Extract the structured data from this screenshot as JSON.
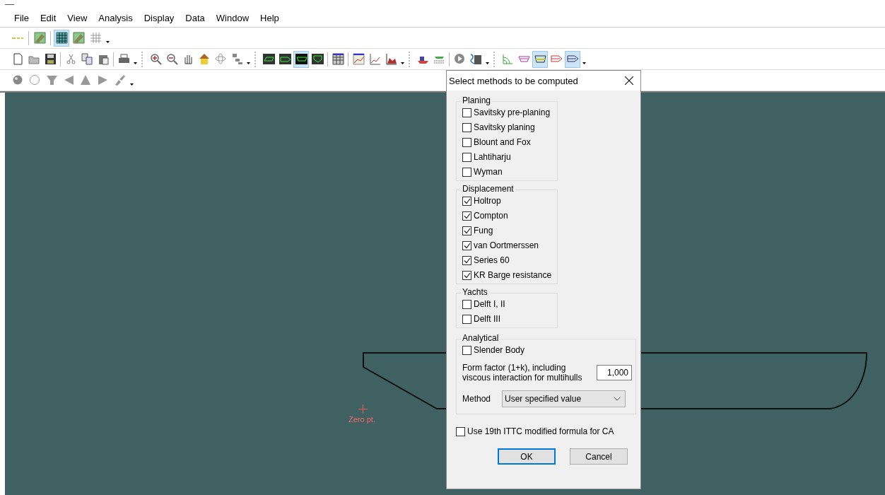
{
  "menu": [
    "File",
    "Edit",
    "View",
    "Analysis",
    "Display",
    "Data",
    "Window",
    "Help"
  ],
  "toolbars": [
    [
      {
        "kind": "dashline",
        "selected": false
      },
      {
        "kind": "separator"
      },
      {
        "kind": "hullgrid",
        "selected": false
      },
      {
        "kind": "separator"
      },
      {
        "kind": "grid",
        "selected": true
      },
      {
        "kind": "hullgrid",
        "selected": false
      },
      {
        "kind": "lightgrid",
        "selected": false
      },
      {
        "kind": "dropdown"
      }
    ],
    [
      {
        "kind": "document",
        "selected": false
      },
      {
        "kind": "folder",
        "selected": false
      },
      {
        "kind": "save",
        "selected": false
      },
      {
        "kind": "separator"
      },
      {
        "kind": "scissors",
        "selected": false
      },
      {
        "kind": "copy",
        "selected": false
      },
      {
        "kind": "paste",
        "selected": false
      },
      {
        "kind": "separator"
      },
      {
        "kind": "printer",
        "selected": false
      },
      {
        "kind": "dropdown"
      },
      {
        "kind": "grip"
      },
      {
        "kind": "zoomin",
        "selected": false
      },
      {
        "kind": "zoomout",
        "selected": false
      },
      {
        "kind": "hand",
        "selected": false
      },
      {
        "kind": "house",
        "selected": false
      },
      {
        "kind": "rotate",
        "selected": false
      },
      {
        "kind": "tree",
        "selected": false
      },
      {
        "kind": "dropdown"
      },
      {
        "kind": "grip"
      },
      {
        "kind": "hullperspective",
        "selected": false
      },
      {
        "kind": "hullprofile",
        "selected": false
      },
      {
        "kind": "hullplan",
        "selected": true
      },
      {
        "kind": "hullbody",
        "selected": false
      },
      {
        "kind": "separator"
      },
      {
        "kind": "table",
        "selected": false
      },
      {
        "kind": "separator"
      },
      {
        "kind": "gridchart",
        "selected": false
      },
      {
        "kind": "linechart",
        "selected": false
      },
      {
        "kind": "areachart",
        "selected": false
      },
      {
        "kind": "dropdown"
      },
      {
        "kind": "grip"
      },
      {
        "kind": "ship",
        "selected": false
      },
      {
        "kind": "shiplist",
        "selected": false
      },
      {
        "kind": "separator"
      },
      {
        "kind": "play",
        "selected": false
      },
      {
        "kind": "calculator",
        "selected": false
      },
      {
        "kind": "dropdown"
      },
      {
        "kind": "grip"
      },
      {
        "kind": "bodylines",
        "selected": false
      },
      {
        "kind": "planlines",
        "selected": false
      },
      {
        "kind": "profilelines",
        "selected": true
      },
      {
        "kind": "redlines",
        "selected": false
      },
      {
        "kind": "sidelines",
        "selected": true
      },
      {
        "kind": "dropdown"
      }
    ],
    [
      {
        "kind": "sphere",
        "selected": false
      },
      {
        "kind": "circle",
        "selected": false
      },
      {
        "kind": "funnel",
        "selected": false
      },
      {
        "kind": "leftwedge",
        "selected": false
      },
      {
        "kind": "pyramid",
        "selected": false
      },
      {
        "kind": "rightwedge",
        "selected": false
      },
      {
        "kind": "brush",
        "selected": false
      },
      {
        "kind": "dropdown"
      }
    ]
  ],
  "canvas": {
    "marker_label": "Zero pt."
  },
  "dialog": {
    "title": "Select methods to be computed",
    "groups": [
      {
        "label": "Planing",
        "options": [
          {
            "label": "Savitsky pre-planing",
            "checked": false
          },
          {
            "label": "Savitsky planing",
            "checked": false
          },
          {
            "label": "Blount and Fox",
            "checked": false
          },
          {
            "label": "Lahtiharju",
            "checked": false
          },
          {
            "label": "Wyman",
            "checked": false
          }
        ]
      },
      {
        "label": "Displacement",
        "options": [
          {
            "label": "Holtrop",
            "checked": true
          },
          {
            "label": "Compton",
            "checked": true
          },
          {
            "label": "Fung",
            "checked": true
          },
          {
            "label": "van Oortmerssen",
            "checked": true
          },
          {
            "label": "Series 60",
            "checked": true
          },
          {
            "label": "KR Barge resistance",
            "checked": true
          }
        ]
      },
      {
        "label": "Yachts",
        "options": [
          {
            "label": "Delft I, II",
            "checked": false
          },
          {
            "label": "Delft III",
            "checked": false
          }
        ]
      }
    ],
    "analytical": {
      "label": "Analytical",
      "options": [
        {
          "label": "Slender Body",
          "checked": false
        }
      ],
      "form_factor_label": "Form factor (1+k), including viscous interaction for multihulls",
      "form_factor_value": "1,000",
      "method_label": "Method",
      "method_value": "User specified value"
    },
    "ittc": {
      "label": "Use 19th ITTC modified formula for CA",
      "checked": false
    },
    "buttons": [
      {
        "label": "OK",
        "default": true
      },
      {
        "label": "Cancel",
        "default": false
      }
    ]
  }
}
